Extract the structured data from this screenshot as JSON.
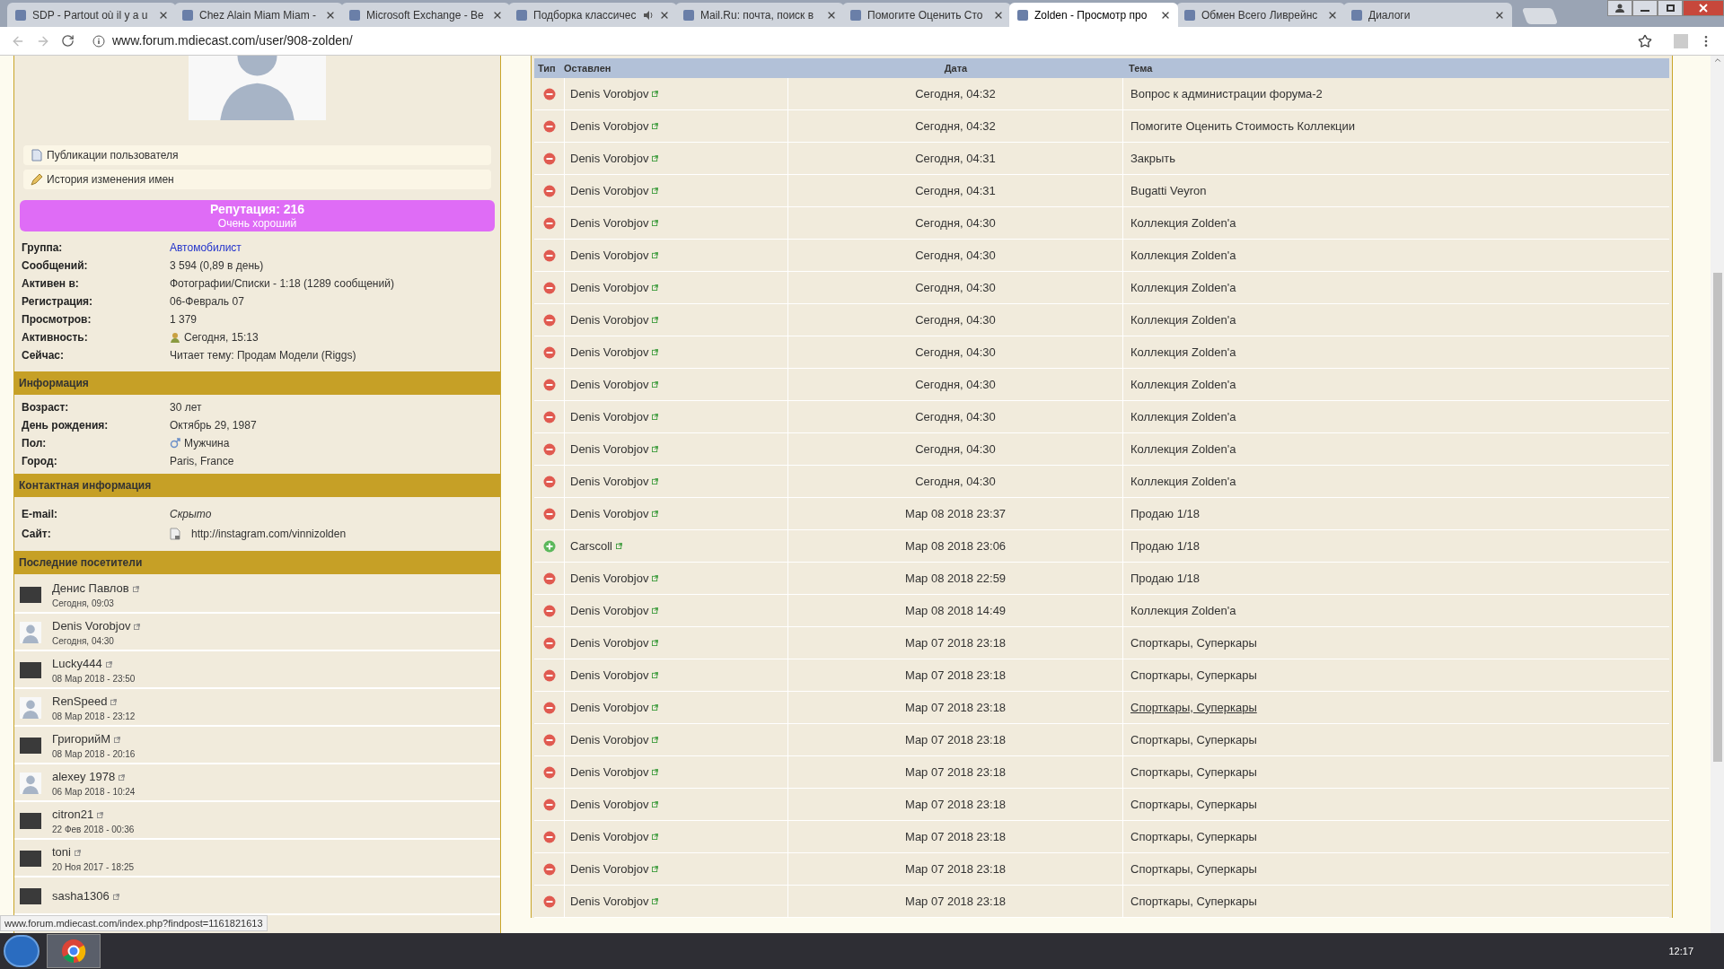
{
  "browser": {
    "tabs": [
      {
        "title": "SDP - Partout où il y a u",
        "selected": false,
        "audio": false
      },
      {
        "title": "Chez Alain Miam Miam -",
        "selected": false,
        "audio": false
      },
      {
        "title": "Microsoft Exchange - Be",
        "selected": false,
        "audio": false
      },
      {
        "title": "Подборка классичес",
        "selected": false,
        "audio": true
      },
      {
        "title": "Mail.Ru: почта, поиск в",
        "selected": false,
        "audio": false
      },
      {
        "title": "Помогите Оценить Сто",
        "selected": false,
        "audio": false
      },
      {
        "title": "Zolden - Просмотр про",
        "selected": true,
        "audio": false
      },
      {
        "title": "Обмен Всего Ливрейнс",
        "selected": false,
        "audio": false
      },
      {
        "title": "Диалоги",
        "selected": false,
        "audio": false
      }
    ],
    "url": "www.forum.mdiecast.com/user/908-zolden/",
    "status_url": "www.forum.mdiecast.com/index.php?findpost=1161821613"
  },
  "profile": {
    "links": [
      "Публикации пользователя",
      "История изменения имен"
    ],
    "reputation": {
      "title": "Репутация: 216",
      "subtitle": "Очень хороший"
    },
    "stats": [
      {
        "label": "Группа:",
        "value": "Автомобилист",
        "kind": "link"
      },
      {
        "label": "Сообщений:",
        "value": "3 594 (0,89 в день)",
        "kind": "text"
      },
      {
        "label": "Активен в:",
        "value": "Фотографии/Списки - 1:18 (1289 сообщений)",
        "kind": "text"
      },
      {
        "label": "Регистрация:",
        "value": "06-Февраль 07",
        "kind": "text"
      },
      {
        "label": "Просмотров:",
        "value": "1 379",
        "kind": "text"
      },
      {
        "label": "Активность:",
        "value": "Сегодня, 15:13",
        "kind": "activity"
      },
      {
        "label": "Сейчас:",
        "value": "Читает тему: Продам Модели (Riggs)",
        "kind": "text"
      }
    ],
    "info": {
      "title": "Информация",
      "rows": [
        {
          "label": "Возраст:",
          "value": "30 лет",
          "kind": "text"
        },
        {
          "label": "День рождения:",
          "value": "Октябрь 29, 1987",
          "kind": "text"
        },
        {
          "label": "Пол:",
          "value": "Мужчина",
          "kind": "gender"
        },
        {
          "label": "Город:",
          "value": "Paris, France",
          "kind": "text"
        }
      ]
    },
    "contact": {
      "title": "Контактная информация",
      "rows": [
        {
          "label": "E-mail:",
          "value": "Скрыто",
          "kind": "hidden"
        },
        {
          "label": "Сайт:",
          "value": "http://instagram.com/vinnizolden",
          "kind": "site"
        }
      ]
    },
    "visitors": {
      "title": "Последние посетители",
      "items": [
        {
          "name": "Денис Павлов",
          "date": "Сегодня, 09:03",
          "kind": "photo"
        },
        {
          "name": "Denis Vorobjov",
          "date": "Сегодня, 04:30",
          "kind": "default"
        },
        {
          "name": "Lucky444",
          "date": "08 Мар 2018 - 23:50",
          "kind": "photo"
        },
        {
          "name": "RenSpeed",
          "date": "08 Мар 2018 - 23:12",
          "kind": "default"
        },
        {
          "name": "ГригорийМ",
          "date": "08 Мар 2018 - 20:16",
          "kind": "photo"
        },
        {
          "name": "alexey 1978",
          "date": "06 Мар 2018 - 10:24",
          "kind": "default"
        },
        {
          "name": "citron21",
          "date": "22 Фев 2018 - 00:36",
          "kind": "photo"
        },
        {
          "name": "toni",
          "date": "20 Ноя 2017 - 18:25",
          "kind": "photo"
        },
        {
          "name": "sasha1306",
          "kind": "photo"
        }
      ]
    }
  },
  "table": {
    "columns": [
      "Тип",
      "Оставлен",
      "Дата",
      "Тема"
    ],
    "rows": [
      {
        "kind": "minus",
        "author": "Denis Vorobjov",
        "date": "Сегодня, 04:32",
        "topic": "Вопрос к администрации форума-2",
        "hovered": false
      },
      {
        "kind": "minus",
        "author": "Denis Vorobjov",
        "date": "Сегодня, 04:32",
        "topic": "Помогите Оценить Стоимость Коллекции",
        "hovered": false
      },
      {
        "kind": "minus",
        "author": "Denis Vorobjov",
        "date": "Сегодня, 04:31",
        "topic": "Закрыть",
        "hovered": false
      },
      {
        "kind": "minus",
        "author": "Denis Vorobjov",
        "date": "Сегодня, 04:31",
        "topic": "Bugatti Veyron",
        "hovered": false
      },
      {
        "kind": "minus",
        "author": "Denis Vorobjov",
        "date": "Сегодня, 04:30",
        "topic": "Коллекция Zolden'a",
        "hovered": false
      },
      {
        "kind": "minus",
        "author": "Denis Vorobjov",
        "date": "Сегодня, 04:30",
        "topic": "Коллекция Zolden'a",
        "hovered": false
      },
      {
        "kind": "minus",
        "author": "Denis Vorobjov",
        "date": "Сегодня, 04:30",
        "topic": "Коллекция Zolden'a",
        "hovered": false
      },
      {
        "kind": "minus",
        "author": "Denis Vorobjov",
        "date": "Сегодня, 04:30",
        "topic": "Коллекция Zolden'a",
        "hovered": false
      },
      {
        "kind": "minus",
        "author": "Denis Vorobjov",
        "date": "Сегодня, 04:30",
        "topic": "Коллекция Zolden'a",
        "hovered": false
      },
      {
        "kind": "minus",
        "author": "Denis Vorobjov",
        "date": "Сегодня, 04:30",
        "topic": "Коллекция Zolden'a",
        "hovered": false
      },
      {
        "kind": "minus",
        "author": "Denis Vorobjov",
        "date": "Сегодня, 04:30",
        "topic": "Коллекция Zolden'a",
        "hovered": false
      },
      {
        "kind": "minus",
        "author": "Denis Vorobjov",
        "date": "Сегодня, 04:30",
        "topic": "Коллекция Zolden'a",
        "hovered": false
      },
      {
        "kind": "minus",
        "author": "Denis Vorobjov",
        "date": "Сегодня, 04:30",
        "topic": "Коллекция Zolden'a",
        "hovered": false
      },
      {
        "kind": "minus",
        "author": "Denis Vorobjov",
        "date": "Мар 08 2018 23:37",
        "topic": "Продаю 1/18",
        "hovered": false
      },
      {
        "kind": "plus",
        "author": "Carscoll",
        "date": "Мар 08 2018 23:06",
        "topic": "Продаю 1/18",
        "hovered": false
      },
      {
        "kind": "minus",
        "author": "Denis Vorobjov",
        "date": "Мар 08 2018 22:59",
        "topic": "Продаю 1/18",
        "hovered": false
      },
      {
        "kind": "minus",
        "author": "Denis Vorobjov",
        "date": "Мар 08 2018 14:49",
        "topic": "Коллекция Zolden'a",
        "hovered": false
      },
      {
        "kind": "minus",
        "author": "Denis Vorobjov",
        "date": "Мар 07 2018 23:18",
        "topic": "Спорткары, Суперкары",
        "hovered": false
      },
      {
        "kind": "minus",
        "author": "Denis Vorobjov",
        "date": "Мар 07 2018 23:18",
        "topic": "Спорткары, Суперкары",
        "hovered": false
      },
      {
        "kind": "minus",
        "author": "Denis Vorobjov",
        "date": "Мар 07 2018 23:18",
        "topic": "Спорткары, Суперкары",
        "hovered": true
      },
      {
        "kind": "minus",
        "author": "Denis Vorobjov",
        "date": "Мар 07 2018 23:18",
        "topic": "Спорткары, Суперкары",
        "hovered": false
      },
      {
        "kind": "minus",
        "author": "Denis Vorobjov",
        "date": "Мар 07 2018 23:18",
        "topic": "Спорткары, Суперкары",
        "hovered": false
      },
      {
        "kind": "minus",
        "author": "Denis Vorobjov",
        "date": "Мар 07 2018 23:18",
        "topic": "Спорткары, Суперкары",
        "hovered": false
      },
      {
        "kind": "minus",
        "author": "Denis Vorobjov",
        "date": "Мар 07 2018 23:18",
        "topic": "Спорткары, Суперкары",
        "hovered": false
      },
      {
        "kind": "minus",
        "author": "Denis Vorobjov",
        "date": "Мар 07 2018 23:18",
        "topic": "Спорткары, Суперкары",
        "hovered": false
      },
      {
        "kind": "minus",
        "author": "Denis Vorobjov",
        "date": "Мар 07 2018 23:18",
        "topic": "Спорткары, Суперкары",
        "hovered": false
      }
    ]
  },
  "taskbar": {
    "clock": "12:17"
  }
}
